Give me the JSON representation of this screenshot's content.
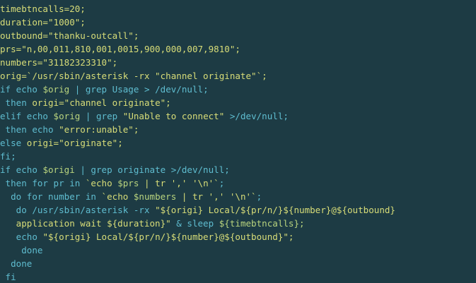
{
  "colors": {
    "background": "#1d3b44",
    "text": "#d8dd78",
    "keyword": "#5fbdd0",
    "variable": "#b9d47e"
  },
  "code": {
    "lines": [
      [
        {
          "t": "timebtncalls=20;",
          "c": "v"
        }
      ],
      [
        {
          "t": "duration=\"1000\";",
          "c": "v"
        }
      ],
      [
        {
          "t": "outbound=\"thanku-outcall\";",
          "c": "v"
        }
      ],
      [
        {
          "t": "prs=\"n,00,011,810,001,0015,900,000,007,9810\";",
          "c": "v"
        }
      ],
      [
        {
          "t": "numbers=\"31182323310\";",
          "c": "v"
        }
      ],
      [
        {
          "t": "orig=`/usr/sbin/asterisk -rx \"channel originate\"`;",
          "c": "v"
        }
      ],
      [
        {
          "t": "if",
          "c": "k"
        },
        {
          "t": " echo ",
          "c": "k"
        },
        {
          "t": "$orig",
          "c": "x"
        },
        {
          "t": " | grep Usage > /dev/null;",
          "c": "k"
        }
      ],
      [
        {
          "t": " then ",
          "c": "k"
        },
        {
          "t": "origi=\"channel originate\";",
          "c": "s"
        }
      ],
      [
        {
          "t": "elif echo ",
          "c": "k"
        },
        {
          "t": "$orig",
          "c": "x"
        },
        {
          "t": " | grep ",
          "c": "k"
        },
        {
          "t": "\"Unable to connect\"",
          "c": "s"
        },
        {
          "t": " >/dev/null;",
          "c": "k"
        }
      ],
      [
        {
          "t": " then echo ",
          "c": "k"
        },
        {
          "t": "\"error:unable\";",
          "c": "s"
        }
      ],
      [
        {
          "t": "else ",
          "c": "k"
        },
        {
          "t": "origi=\"originate\";",
          "c": "s"
        }
      ],
      [
        {
          "t": "fi;",
          "c": "k"
        }
      ],
      [
        {
          "t": "if echo ",
          "c": "k"
        },
        {
          "t": "$origi",
          "c": "x"
        },
        {
          "t": " | grep originate >/dev/null;",
          "c": "k"
        }
      ],
      [
        {
          "t": " then for pr in ",
          "c": "k"
        },
        {
          "t": "`echo ",
          "c": "s"
        },
        {
          "t": "$prs",
          "c": "x"
        },
        {
          "t": " | tr ',' '\\n'`",
          "c": "s"
        },
        {
          "t": ";",
          "c": "k"
        }
      ],
      [
        {
          "t": "  do for number in ",
          "c": "k"
        },
        {
          "t": "`echo ",
          "c": "s"
        },
        {
          "t": "$numbers",
          "c": "x"
        },
        {
          "t": " | tr ',' '\\n'`",
          "c": "s"
        },
        {
          "t": ";",
          "c": "k"
        }
      ],
      [
        {
          "t": "   do /usr/sbin/asterisk -rx ",
          "c": "k"
        },
        {
          "t": "\"${origi} Local/${pr/n/}${number}@${outbound}",
          "c": "s"
        }
      ],
      [
        {
          "t": "   application wait ${duration}\"",
          "c": "s"
        },
        {
          "t": " & sleep ",
          "c": "k"
        },
        {
          "t": "${timebtncalls};",
          "c": "x"
        }
      ],
      [
        {
          "t": "   echo ",
          "c": "k"
        },
        {
          "t": "\"${origi} Local/${pr/n/}${number}@${outbound}\";",
          "c": "s"
        }
      ],
      [
        {
          "t": "    done",
          "c": "k"
        }
      ],
      [
        {
          "t": "  done",
          "c": "k"
        }
      ],
      [
        {
          "t": " fi",
          "c": "k"
        }
      ]
    ]
  }
}
